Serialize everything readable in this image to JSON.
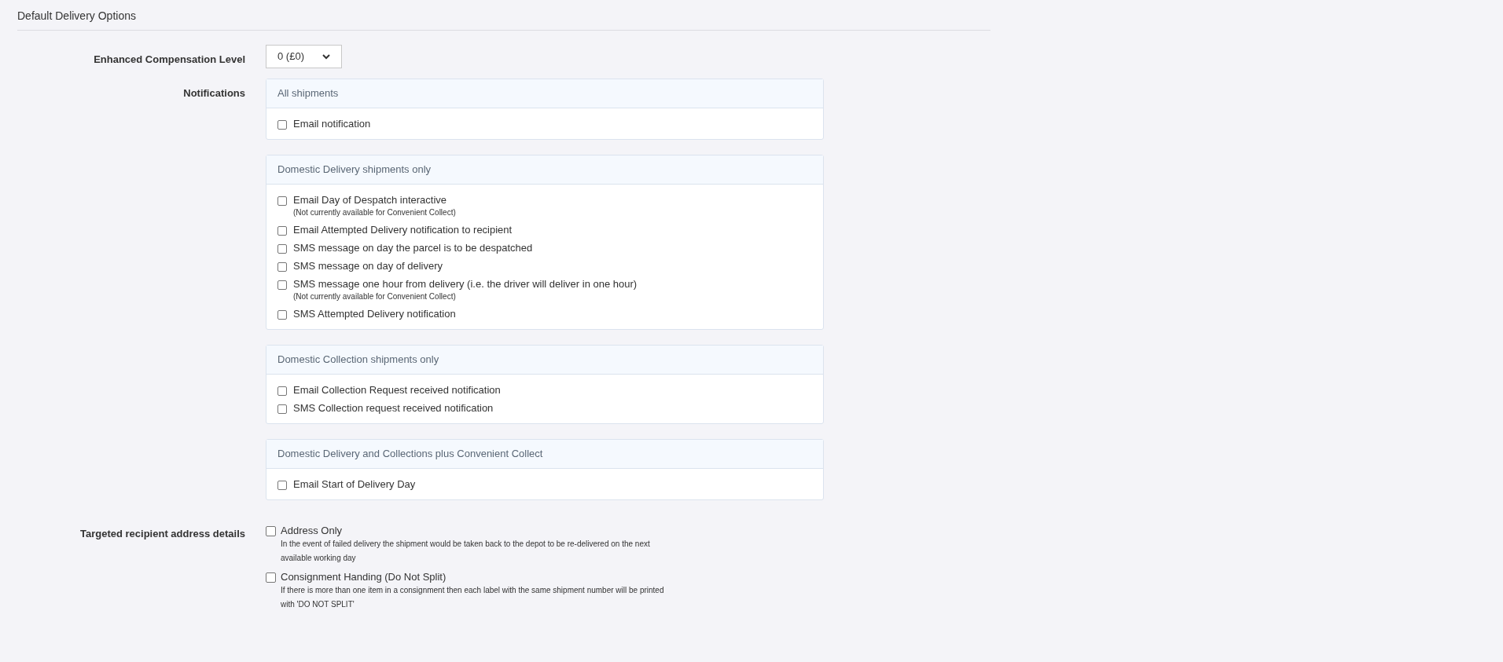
{
  "section_title": "Default Delivery Options",
  "compensation": {
    "label": "Enhanced Compensation Level",
    "value": "0 (£0)"
  },
  "notifications": {
    "label": "Notifications",
    "groups": [
      {
        "title": "All shipments",
        "options": [
          {
            "label": "Email notification",
            "checked": false
          }
        ]
      },
      {
        "title": "Domestic Delivery shipments only",
        "options": [
          {
            "label": "Email Day of Despatch interactive",
            "note": "(Not currently available for Convenient Collect)",
            "checked": false
          },
          {
            "label": "Email Attempted Delivery notification to recipient",
            "checked": false
          },
          {
            "label": "SMS message on day the parcel is to be despatched",
            "checked": false
          },
          {
            "label": "SMS message on day of delivery",
            "checked": false
          },
          {
            "label": "SMS message one hour from delivery (i.e. the driver will deliver in one hour)",
            "note": "(Not currently available for Convenient Collect)",
            "checked": false
          },
          {
            "label": "SMS Attempted Delivery notification",
            "checked": false
          }
        ]
      },
      {
        "title": "Domestic Collection shipments only",
        "options": [
          {
            "label": "Email Collection Request received notification",
            "checked": false
          },
          {
            "label": "SMS Collection request received notification",
            "checked": false
          }
        ]
      },
      {
        "title": "Domestic Delivery and Collections plus Convenient Collect",
        "options": [
          {
            "label": "Email Start of Delivery Day",
            "checked": false
          }
        ]
      }
    ]
  },
  "targeted": {
    "label": "Targeted recipient address details",
    "options": [
      {
        "label": "Address Only",
        "description": "In the event of failed delivery the shipment would be taken back to the depot to be re-delivered on the next available working day",
        "checked": false
      },
      {
        "label": "Consignment Handing (Do Not Split)",
        "description": "If there is more than one item in a consignment then each label with the same shipment number will be printed with 'DO NOT SPLIT'",
        "checked": false
      }
    ]
  }
}
